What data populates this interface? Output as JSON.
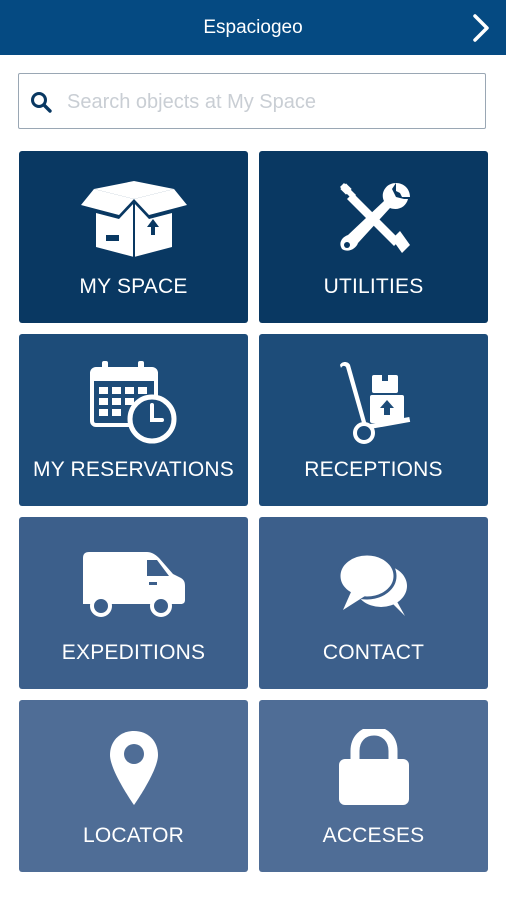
{
  "header": {
    "title": "Espaciogeo",
    "next_icon": "chevron-right-icon"
  },
  "search": {
    "placeholder": "Search objects at My Space",
    "value": "",
    "icon": "search-icon"
  },
  "tiles": [
    {
      "label": "MY SPACE",
      "icon": "box-icon",
      "color": "#093862"
    },
    {
      "label": "UTILITIES",
      "icon": "tools-icon",
      "color": "#093862"
    },
    {
      "label": "MY RESERVATIONS",
      "icon": "calendar-clock-icon",
      "color": "#1d4c79"
    },
    {
      "label": "RECEPTIONS",
      "icon": "hand-truck-icon",
      "color": "#1d4c79"
    },
    {
      "label": "EXPEDITIONS",
      "icon": "van-icon",
      "color": "#3c5f8b"
    },
    {
      "label": "CONTACT",
      "icon": "chat-bubbles-icon",
      "color": "#3c5f8b"
    },
    {
      "label": "LOCATOR",
      "icon": "map-pin-icon",
      "color": "#4f6d96"
    },
    {
      "label": "ACCESES",
      "icon": "lock-icon",
      "color": "#4f6d96"
    }
  ],
  "colors": {
    "header": "#054a82",
    "search_icon": "#093862",
    "placeholder": "#c9ced4"
  }
}
